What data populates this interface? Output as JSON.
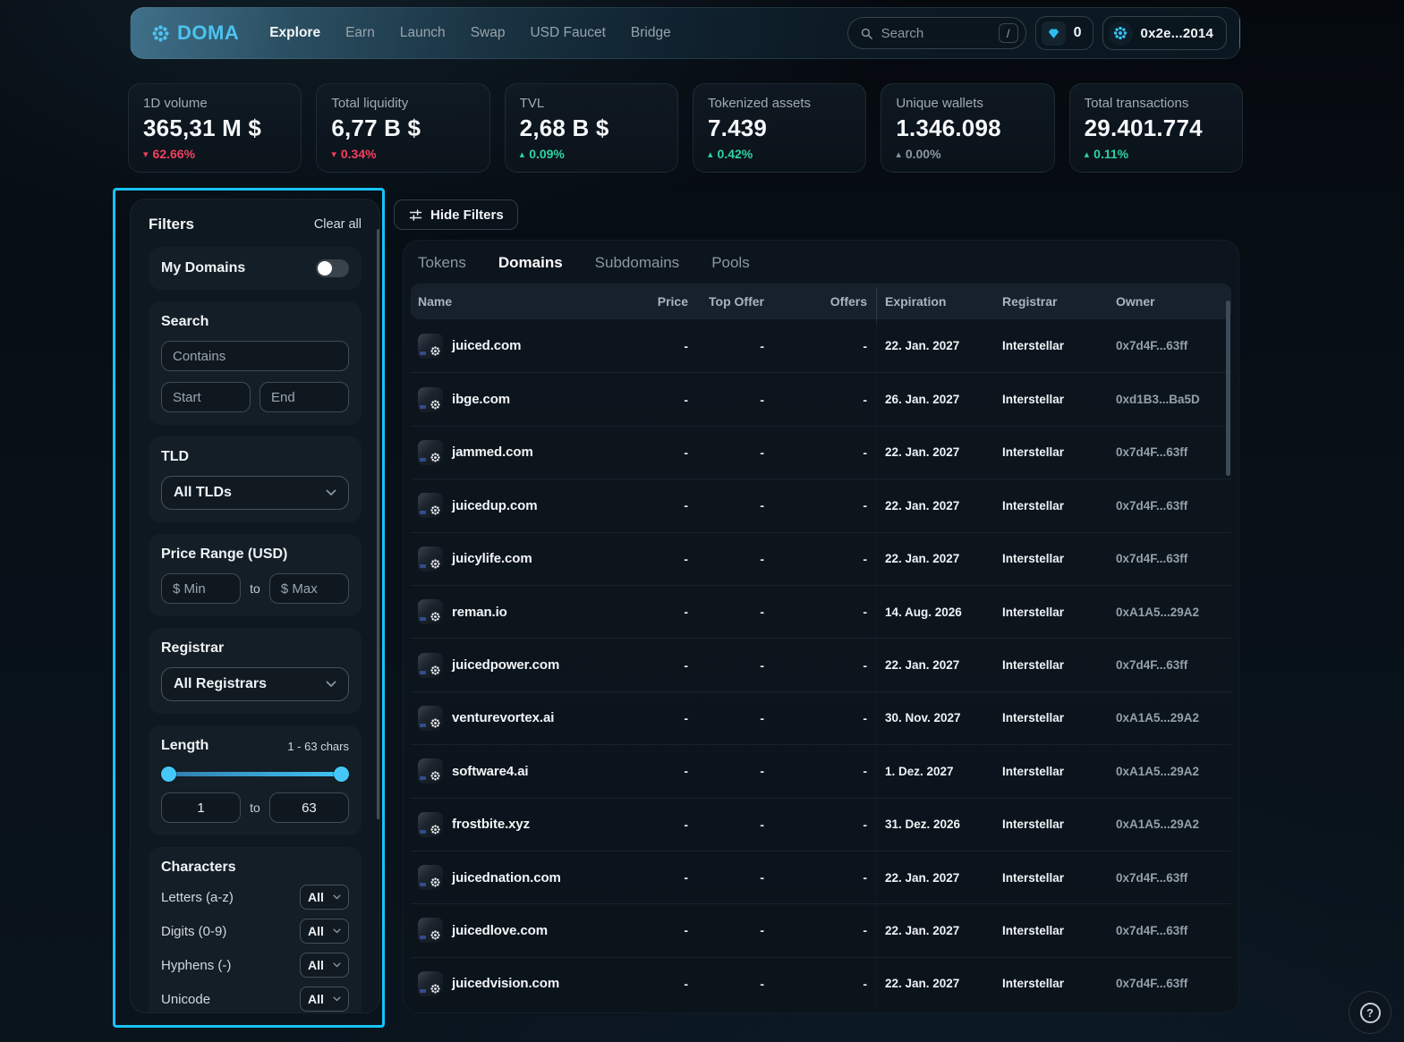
{
  "nav": {
    "brand": "DOMA",
    "items": [
      {
        "label": "Explore",
        "active": true
      },
      {
        "label": "Earn"
      },
      {
        "label": "Launch"
      },
      {
        "label": "Swap"
      },
      {
        "label": "USD Faucet"
      },
      {
        "label": "Bridge"
      }
    ],
    "search": {
      "placeholder": "Search",
      "shortcut": "/"
    },
    "gem_count": "0",
    "wallet_address": "0x2e...2014"
  },
  "stats": [
    {
      "label": "1D volume",
      "value": "365,31 M $",
      "arrow": "▾",
      "delta": "62.66%"
    },
    {
      "label": "Total liquidity",
      "value": "6,77 B $",
      "arrow": "▾",
      "delta": "0.34%"
    },
    {
      "label": "TVL",
      "value": "2,68 B $",
      "arrow": "▴",
      "delta": "0.09%"
    },
    {
      "label": "Tokenized assets",
      "value": "7.439",
      "arrow": "▴",
      "delta": "0.42%"
    },
    {
      "label": "Unique wallets",
      "value": "1.346.098",
      "arrow": "▴",
      "delta": "0.00%"
    },
    {
      "label": "Total transactions",
      "value": "29.401.774",
      "arrow": "▴",
      "delta": "0.11%"
    }
  ],
  "filters": {
    "title": "Filters",
    "clear_all": "Clear all",
    "my_domains": {
      "label": "My Domains",
      "enabled": false
    },
    "search": {
      "title": "Search",
      "contains_placeholder": "Contains",
      "start_placeholder": "Start",
      "end_placeholder": "End"
    },
    "tld": {
      "title": "TLD",
      "selected": "All TLDs"
    },
    "price_range": {
      "title": "Price Range (USD)",
      "min_placeholder": "$ Min",
      "to_label": "to",
      "max_placeholder": "$ Max"
    },
    "registrar": {
      "title": "Registrar",
      "selected": "All Registrars"
    },
    "length": {
      "title": "Length",
      "range_label": "1 - 63 chars",
      "min_value": "1",
      "to_label": "to",
      "max_value": "63"
    },
    "characters": {
      "title": "Characters",
      "rows": [
        {
          "label": "Letters (a-z)",
          "value": "All"
        },
        {
          "label": "Digits (0-9)",
          "value": "All"
        },
        {
          "label": "Hyphens (-)",
          "value": "All"
        },
        {
          "label": "Unicode",
          "value": "All"
        }
      ]
    }
  },
  "toolbar": {
    "hide_filters_label": "Hide Filters"
  },
  "tabs": [
    {
      "label": "Tokens"
    },
    {
      "label": "Domains",
      "active": true
    },
    {
      "label": "Subdomains"
    },
    {
      "label": "Pools"
    }
  ],
  "table": {
    "columns": [
      "Name",
      "Price",
      "Top Offer",
      "Offers",
      "Expiration",
      "Registrar",
      "Owner"
    ],
    "rows": [
      {
        "name": "juiced.com",
        "price": "-",
        "top_offer": "-",
        "offers": "-",
        "expiration": "22. Jan. 2027",
        "registrar": "Interstellar",
        "owner": "0x7d4F...63ff"
      },
      {
        "name": "ibge.com",
        "price": "-",
        "top_offer": "-",
        "offers": "-",
        "expiration": "26. Jan. 2027",
        "registrar": "Interstellar",
        "owner": "0xd1B3...Ba5D"
      },
      {
        "name": "jammed.com",
        "price": "-",
        "top_offer": "-",
        "offers": "-",
        "expiration": "22. Jan. 2027",
        "registrar": "Interstellar",
        "owner": "0x7d4F...63ff"
      },
      {
        "name": "juicedup.com",
        "price": "-",
        "top_offer": "-",
        "offers": "-",
        "expiration": "22. Jan. 2027",
        "registrar": "Interstellar",
        "owner": "0x7d4F...63ff"
      },
      {
        "name": "juicylife.com",
        "price": "-",
        "top_offer": "-",
        "offers": "-",
        "expiration": "22. Jan. 2027",
        "registrar": "Interstellar",
        "owner": "0x7d4F...63ff"
      },
      {
        "name": "reman.io",
        "price": "-",
        "top_offer": "-",
        "offers": "-",
        "expiration": "14. Aug. 2026",
        "registrar": "Interstellar",
        "owner": "0xA1A5...29A2"
      },
      {
        "name": "juicedpower.com",
        "price": "-",
        "top_offer": "-",
        "offers": "-",
        "expiration": "22. Jan. 2027",
        "registrar": "Interstellar",
        "owner": "0x7d4F...63ff"
      },
      {
        "name": "venturevortex.ai",
        "price": "-",
        "top_offer": "-",
        "offers": "-",
        "expiration": "30. Nov. 2027",
        "registrar": "Interstellar",
        "owner": "0xA1A5...29A2"
      },
      {
        "name": "software4.ai",
        "price": "-",
        "top_offer": "-",
        "offers": "-",
        "expiration": "1. Dez. 2027",
        "registrar": "Interstellar",
        "owner": "0xA1A5...29A2"
      },
      {
        "name": "frostbite.xyz",
        "price": "-",
        "top_offer": "-",
        "offers": "-",
        "expiration": "31. Dez. 2026",
        "registrar": "Interstellar",
        "owner": "0xA1A5...29A2"
      },
      {
        "name": "juicednation.com",
        "price": "-",
        "top_offer": "-",
        "offers": "-",
        "expiration": "22. Jan. 2027",
        "registrar": "Interstellar",
        "owner": "0x7d4F...63ff"
      },
      {
        "name": "juicedlove.com",
        "price": "-",
        "top_offer": "-",
        "offers": "-",
        "expiration": "22. Jan. 2027",
        "registrar": "Interstellar",
        "owner": "0x7d4F...63ff"
      },
      {
        "name": "juicedvision.com",
        "price": "-",
        "top_offer": "-",
        "offers": "-",
        "expiration": "22. Jan. 2027",
        "registrar": "Interstellar",
        "owner": "0x7d4F...63ff"
      }
    ]
  },
  "help": {
    "label": "?"
  },
  "colors": {
    "accent": "#38c3f5",
    "positive": "#2dd4a0",
    "negative": "#f43f5e",
    "neutral": "#8b97a1",
    "highlight": "#17c3f7"
  }
}
